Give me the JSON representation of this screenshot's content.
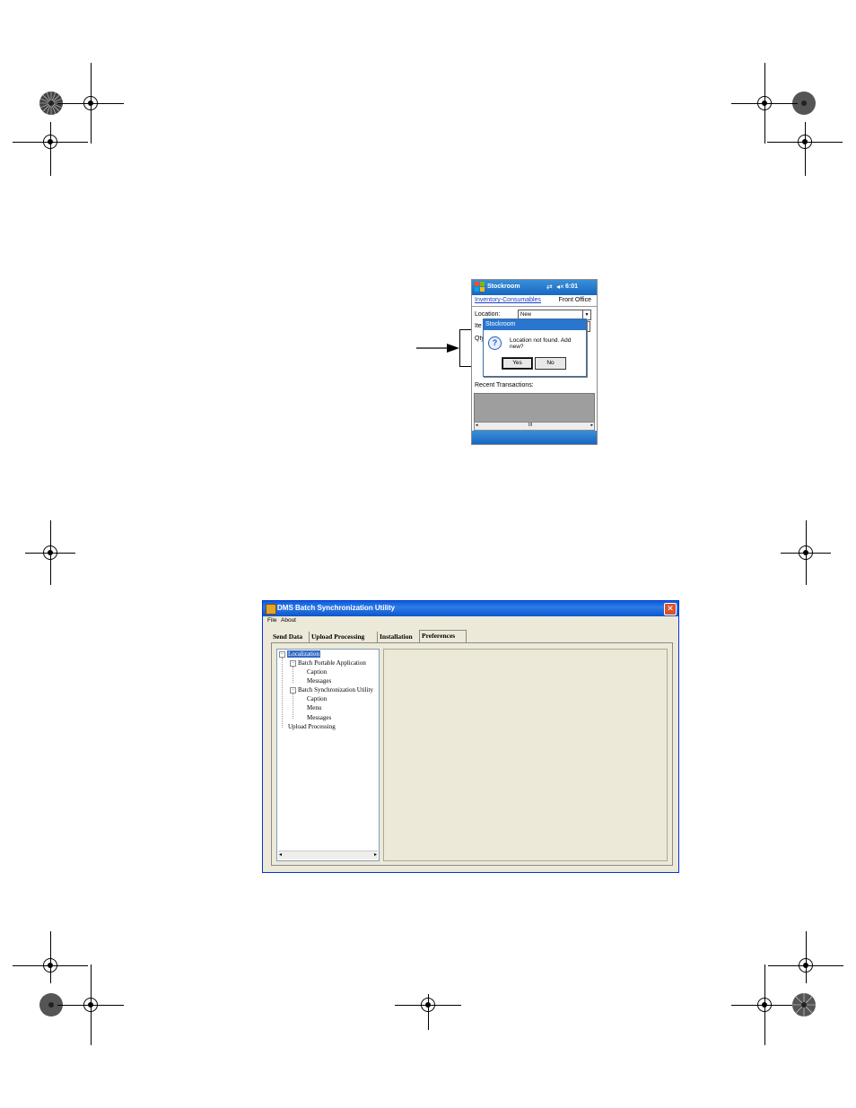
{
  "pda": {
    "title": "Stockroom",
    "time": "6:01",
    "tab_link": "Inventory-Consumables",
    "office": "Front Office",
    "location_label": "Location:",
    "location_value": "New",
    "item_label": "Ite",
    "qty_label": "Qty",
    "dialog": {
      "title": "Stockroom",
      "message": "Location not found. Add new?",
      "yes": "Yes",
      "no": "No"
    },
    "recent_label": "Recent Transactions:",
    "scroll_mid": "III"
  },
  "window": {
    "title": "DMS Batch Synchronization Utility",
    "menu": [
      "File",
      "About"
    ],
    "tabs": [
      "Send Data",
      "Upload Processing",
      "Installation",
      "Preferences"
    ],
    "active_tab": "Preferences",
    "tree": {
      "root": "Localization",
      "bpa": "Batch Portable Application",
      "bpa_caption": "Caption",
      "bpa_messages": "Messages",
      "bsu": "Batch Synchronization Utility",
      "bsu_caption": "Caption",
      "bsu_menu": "Menu",
      "bsu_messages": "Messages",
      "upload": "Upload Processing"
    }
  },
  "colors": {
    "xp_title_blue": "#0a5fd8",
    "pocketpc_blue": "#1767c2",
    "window_bg": "#ece9d8",
    "selection": "#316ac5"
  }
}
